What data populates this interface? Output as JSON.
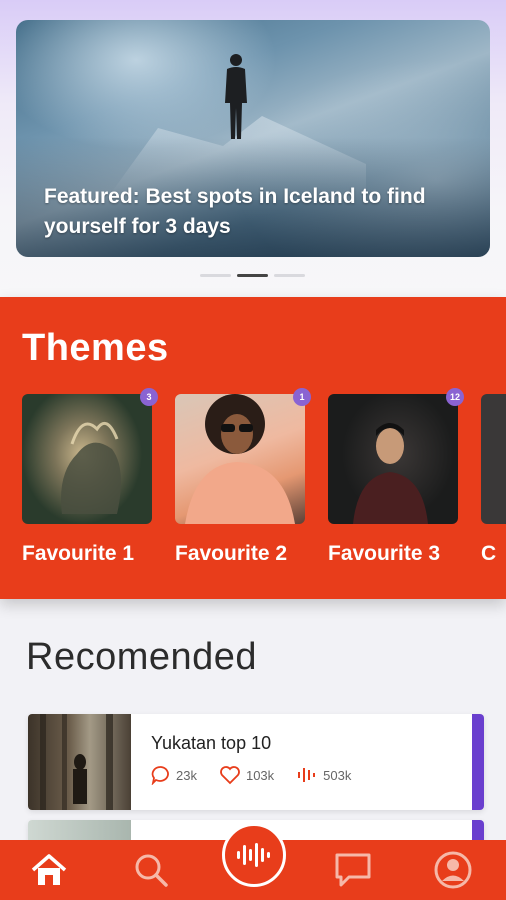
{
  "featured": {
    "title": "Featured: Best spots in Iceland to find yourself for 3 days",
    "pager": {
      "count": 3,
      "active_index": 1
    }
  },
  "themes": {
    "title": "Themes",
    "items": [
      {
        "label": "Favourite 1",
        "badge": "3"
      },
      {
        "label": "Favourite 2",
        "badge": "1"
      },
      {
        "label": "Favourite 3",
        "badge": "12"
      },
      {
        "label": "C",
        "badge": ""
      }
    ]
  },
  "recommended": {
    "title": "Recomended",
    "items": [
      {
        "name": "Yukatan top 10",
        "comments": "23k",
        "likes": "103k",
        "plays": "503k"
      }
    ]
  },
  "bottom_nav": {
    "items": [
      "home-icon",
      "search-icon",
      "podcast-icon",
      "chat-icon",
      "profile-icon"
    ],
    "active": "home-icon"
  },
  "colors": {
    "accent": "#e83d1b",
    "badge": "#8a63d2",
    "card_accent": "#6a3fce"
  }
}
